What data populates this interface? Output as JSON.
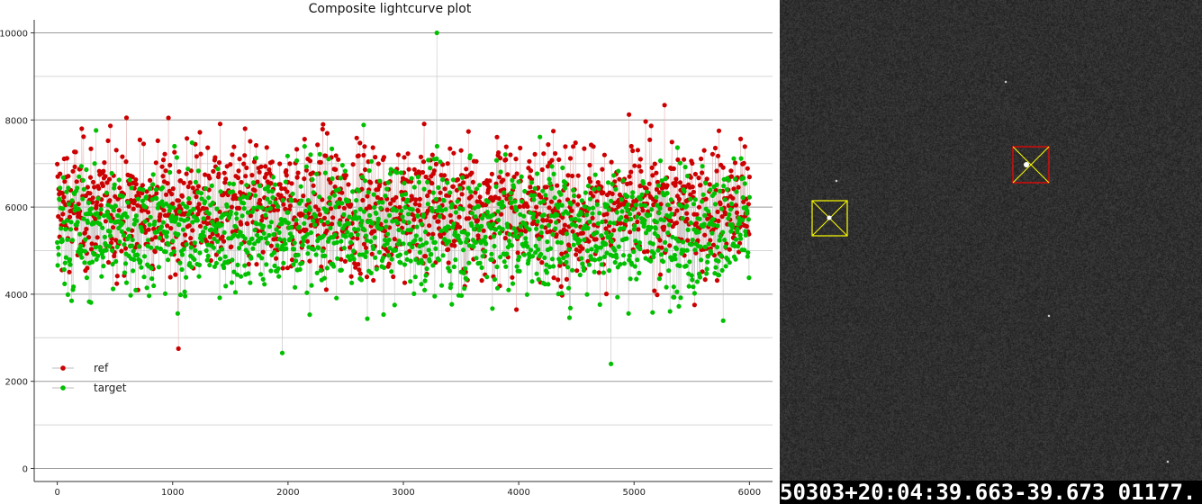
{
  "plot": {
    "title": "Composite lightcurve plot",
    "legend": {
      "placement": "bottom-left",
      "items": [
        {
          "name": "ref",
          "color": "#cc0000"
        },
        {
          "name": "target",
          "color": "#00c000"
        }
      ]
    }
  },
  "chart_data": {
    "type": "scatter",
    "title": "Composite lightcurve plot",
    "xlabel": "",
    "ylabel": "",
    "xlim": [
      -200,
      6200
    ],
    "ylim": [
      -300,
      10300
    ],
    "x_ticks": [
      0,
      1000,
      2000,
      3000,
      4000,
      5000,
      6000
    ],
    "y_ticks": [
      0,
      2000,
      4000,
      6000,
      8000,
      10000
    ],
    "grid": true,
    "series": [
      {
        "name": "ref",
        "color": "#cc0000",
        "mean": 6000,
        "spread_low": 2900,
        "spread_high": 9400,
        "n_points": 6000
      },
      {
        "name": "target",
        "color": "#00c000",
        "mean": 5500,
        "spread_low": 2400,
        "spread_high": 10000,
        "n_points": 6000
      }
    ],
    "notable_points": [
      {
        "series": "target",
        "x": 3290,
        "y": 10000
      },
      {
        "series": "target",
        "x": 4800,
        "y": 2400
      },
      {
        "series": "target",
        "x": 1950,
        "y": 2650
      },
      {
        "series": "ref",
        "x": 1050,
        "y": 2750
      }
    ]
  },
  "frame": {
    "background": "#2c2c2c",
    "timestamp": "50303+20:04:39.663-39.673 01177.",
    "apertures": [
      {
        "label": "target-aperture",
        "color": "#ffff00"
      },
      {
        "label": "ref-aperture",
        "color": "#ff0000"
      }
    ]
  }
}
